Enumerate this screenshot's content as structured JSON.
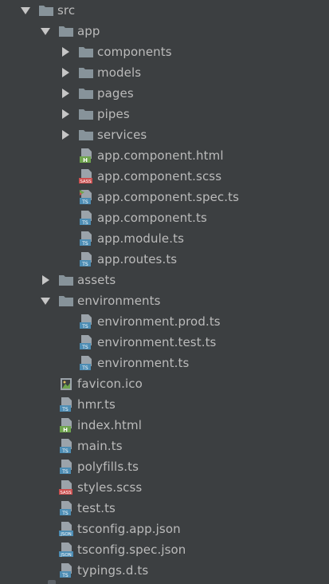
{
  "colors": {
    "background": "#3c3f41",
    "text": "#bbbbbb",
    "folder": "#87939a",
    "ts_badge": "#4d8db4",
    "html_badge": "#6fa44e",
    "sass_badge": "#cc4f4f",
    "json_badge": "#4d8db4"
  },
  "tree": [
    {
      "label": "src",
      "type": "folder",
      "state": "expanded"
    },
    {
      "label": "app",
      "type": "folder",
      "state": "expanded"
    },
    {
      "label": "components",
      "type": "folder",
      "state": "collapsed"
    },
    {
      "label": "models",
      "type": "folder",
      "state": "collapsed"
    },
    {
      "label": "pages",
      "type": "folder",
      "state": "collapsed"
    },
    {
      "label": "pipes",
      "type": "folder",
      "state": "collapsed"
    },
    {
      "label": "services",
      "type": "folder",
      "state": "collapsed"
    },
    {
      "label": "app.component.html",
      "type": "file",
      "filetype": "html"
    },
    {
      "label": "app.component.scss",
      "type": "file",
      "filetype": "sass"
    },
    {
      "label": "app.component.spec.ts",
      "type": "file",
      "filetype": "ts-spec"
    },
    {
      "label": "app.component.ts",
      "type": "file",
      "filetype": "ts"
    },
    {
      "label": "app.module.ts",
      "type": "file",
      "filetype": "ts"
    },
    {
      "label": "app.routes.ts",
      "type": "file",
      "filetype": "ts"
    },
    {
      "label": "assets",
      "type": "folder",
      "state": "collapsed"
    },
    {
      "label": "environments",
      "type": "folder",
      "state": "expanded"
    },
    {
      "label": "environment.prod.ts",
      "type": "file",
      "filetype": "ts"
    },
    {
      "label": "environment.test.ts",
      "type": "file",
      "filetype": "ts"
    },
    {
      "label": "environment.ts",
      "type": "file",
      "filetype": "ts"
    },
    {
      "label": "favicon.ico",
      "type": "file",
      "filetype": "image"
    },
    {
      "label": "hmr.ts",
      "type": "file",
      "filetype": "ts"
    },
    {
      "label": "index.html",
      "type": "file",
      "filetype": "html"
    },
    {
      "label": "main.ts",
      "type": "file",
      "filetype": "ts"
    },
    {
      "label": "polyfills.ts",
      "type": "file",
      "filetype": "ts"
    },
    {
      "label": "styles.scss",
      "type": "file",
      "filetype": "sass"
    },
    {
      "label": "test.ts",
      "type": "file",
      "filetype": "ts"
    },
    {
      "label": "tsconfig.app.json",
      "type": "file",
      "filetype": "json"
    },
    {
      "label": "tsconfig.spec.json",
      "type": "file",
      "filetype": "json"
    },
    {
      "label": "typings.d.ts",
      "type": "file",
      "filetype": "ts"
    }
  ]
}
